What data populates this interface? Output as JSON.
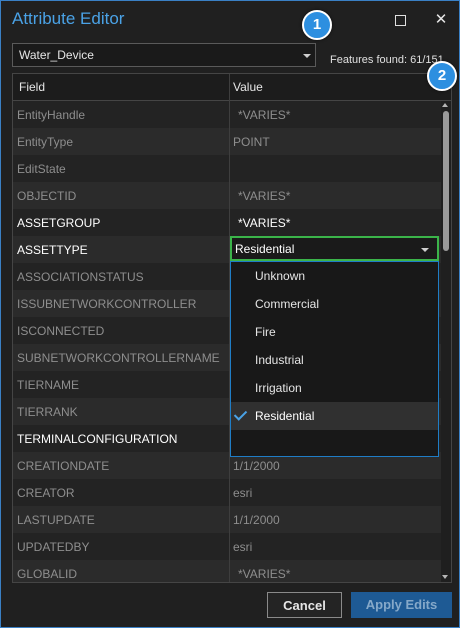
{
  "title": "Attribute Editor",
  "window_buttons": {
    "maximize": "maximize-icon",
    "close": "✕"
  },
  "layer": {
    "selected": "Water_Device"
  },
  "features_found": "Features found: 61/151",
  "badges": [
    "1",
    "2"
  ],
  "grid": {
    "headers": {
      "field": "Field",
      "value": "Value"
    },
    "rows": [
      {
        "field": "EntityHandle",
        "value": "*VARIES*"
      },
      {
        "field": "EntityType",
        "value": "POINT"
      },
      {
        "field": "EditState",
        "value": ""
      },
      {
        "field": "OBJECTID",
        "value": "*VARIES*"
      },
      {
        "field": "ASSETGROUP",
        "value": "*VARIES*"
      },
      {
        "field": "ASSETTYPE",
        "value": "Residential"
      },
      {
        "field": "ASSOCIATIONSTATUS",
        "value": ""
      },
      {
        "field": "ISSUBNETWORKCONTROLLER",
        "value": ""
      },
      {
        "field": "ISCONNECTED",
        "value": ""
      },
      {
        "field": "SUBNETWORKCONTROLLERNAME",
        "value": ""
      },
      {
        "field": "TIERNAME",
        "value": ""
      },
      {
        "field": "TIERRANK",
        "value": ""
      },
      {
        "field": "TERMINALCONFIGURATION",
        "value": ""
      },
      {
        "field": "CREATIONDATE",
        "value": "1/1/2000"
      },
      {
        "field": "CREATOR",
        "value": "esri"
      },
      {
        "field": "LASTUPDATE",
        "value": "1/1/2000"
      },
      {
        "field": "UPDATEDBY",
        "value": "esri"
      },
      {
        "field": "GLOBALID",
        "value": "*VARIES*"
      }
    ]
  },
  "dropdown": {
    "options": [
      "Unknown",
      "Commercial",
      "Fire",
      "Industrial",
      "Irrigation",
      "Residential"
    ],
    "selected": "Residential"
  },
  "buttons": {
    "cancel": "Cancel",
    "apply": "Apply Edits"
  },
  "colors": {
    "accent": "#4aa2e6",
    "focus_border": "#3bb44a",
    "badge": "#2d8fe0"
  }
}
